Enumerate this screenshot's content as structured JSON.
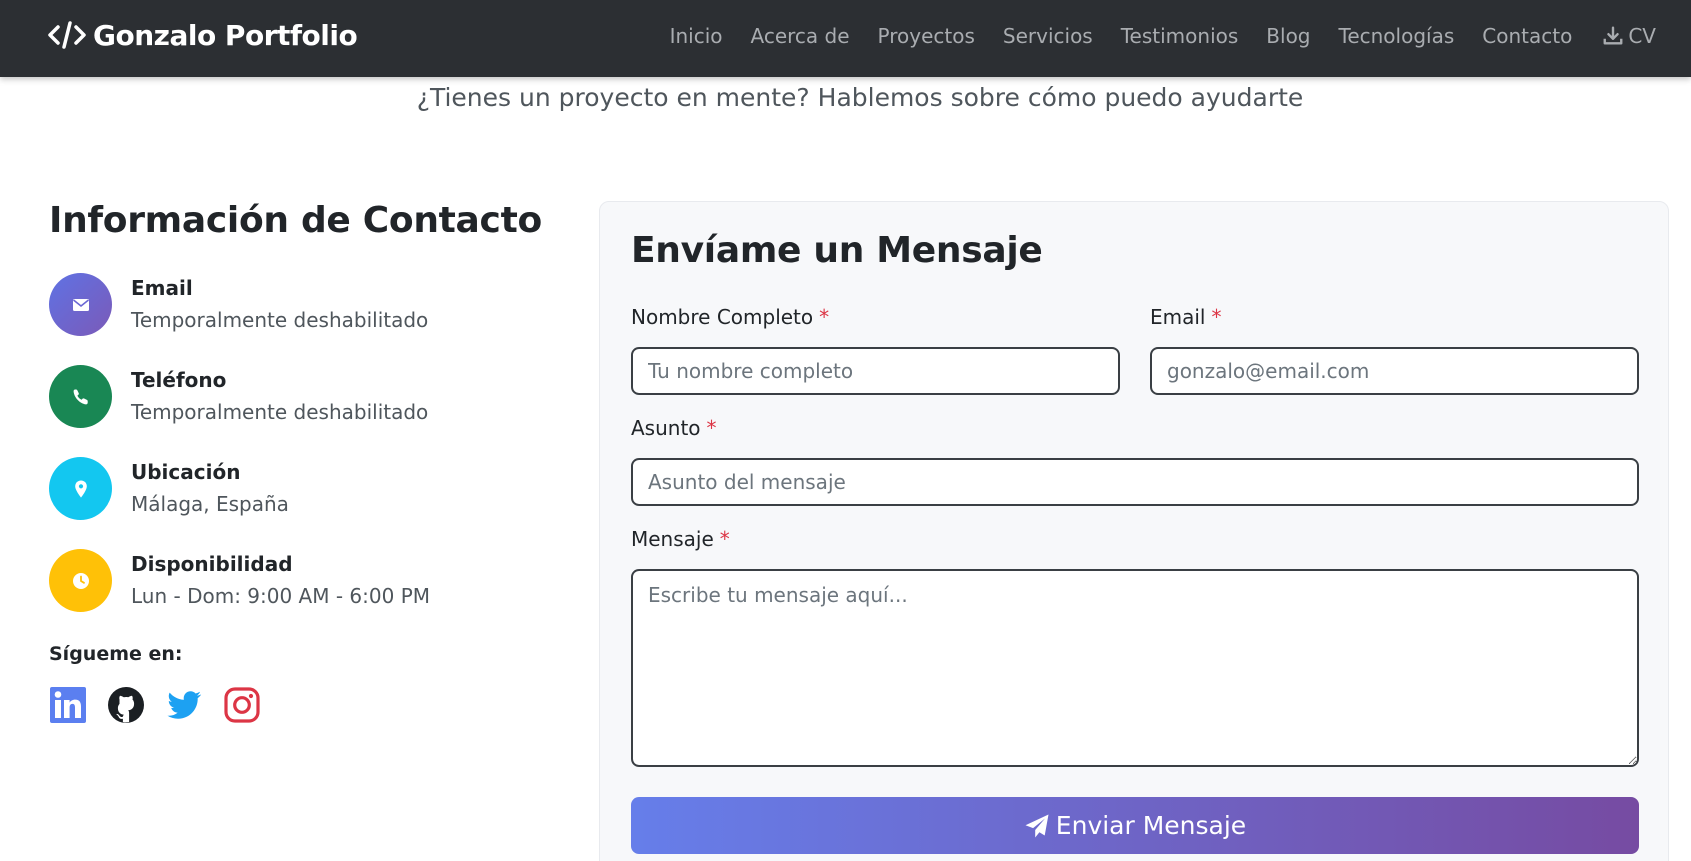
{
  "navbar": {
    "brand": "Gonzalo Portfolio",
    "links": [
      "Inicio",
      "Acerca de",
      "Proyectos",
      "Servicios",
      "Testimonios",
      "Blog",
      "Tecnologías",
      "Contacto"
    ],
    "cv_label": "CV"
  },
  "subtitle": "¿Tienes un proyecto en mente? Hablemos sobre cómo puedo ayudarte",
  "contact_info": {
    "title": "Información de Contacto",
    "items": [
      {
        "label": "Email",
        "value": "Temporalmente deshabilitado",
        "icon": "envelope-icon",
        "color": "#6f6fd8"
      },
      {
        "label": "Teléfono",
        "value": "Temporalmente deshabilitado",
        "icon": "phone-icon",
        "color": "#198754"
      },
      {
        "label": "Ubicación",
        "value": "Málaga, España",
        "icon": "map-pin-icon",
        "color": "#13c7f0"
      },
      {
        "label": "Disponibilidad",
        "value": "Lun - Dom: 9:00 AM - 6:00 PM",
        "icon": "clock-icon",
        "color": "#ffc107"
      }
    ],
    "follow_label": "Sígueme en:",
    "socials": [
      {
        "name": "linkedin-icon",
        "color": "#5b7ff0"
      },
      {
        "name": "github-icon",
        "color": "#1b1f23"
      },
      {
        "name": "twitter-icon",
        "color": "#1da1f2"
      },
      {
        "name": "instagram-icon",
        "color": "#dc3545"
      }
    ]
  },
  "form": {
    "title": "Envíame un Mensaje",
    "required_mark": "*",
    "name_label": "Nombre Completo",
    "name_placeholder": "Tu nombre completo",
    "email_label": "Email",
    "email_placeholder": "gonzalo@email.com",
    "subject_label": "Asunto",
    "subject_placeholder": "Asunto del mensaje",
    "message_label": "Mensaje",
    "message_placeholder": "Escribe tu mensaje aquí...",
    "submit_label": "Enviar Mensaje"
  },
  "colors": {
    "navbar_bg": "#2c2f33",
    "button_gradient_start": "#667eea",
    "button_gradient_end": "#764ba2",
    "required": "#dc3545"
  }
}
